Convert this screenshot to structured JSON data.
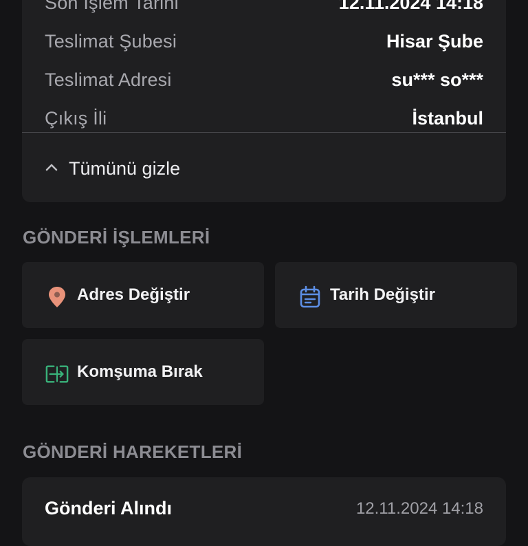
{
  "shipment_details": {
    "rows": [
      {
        "label": "Son İşlem Tarihi",
        "value": "12.11.2024 14:18"
      },
      {
        "label": "Teslimat Şubesi",
        "value": "Hisar Şube"
      },
      {
        "label": "Teslimat Adresi",
        "value": "su*** so***"
      },
      {
        "label": "Çıkış İli",
        "value": "İstanbul"
      }
    ],
    "toggle_label": "Tümünü gizle",
    "toggle_icon": "chevron-up-icon"
  },
  "actions": {
    "title": "GÖNDERİ İŞLEMLERİ",
    "items": [
      {
        "label": "Adres Değiştir",
        "icon": "location-pin-icon",
        "color": "#e8927a"
      },
      {
        "label": "Tarih Değiştir",
        "icon": "calendar-icon",
        "color": "#5d8fe6"
      },
      {
        "label": "Komşuma Bırak",
        "icon": "neighbor-handover-icon",
        "color": "#39b27a"
      }
    ]
  },
  "movements": {
    "title": "GÖNDERİ HAREKETLERİ",
    "items": [
      {
        "title": "Gönderi Alındı",
        "date": "12.11.2024 14:18"
      }
    ]
  }
}
